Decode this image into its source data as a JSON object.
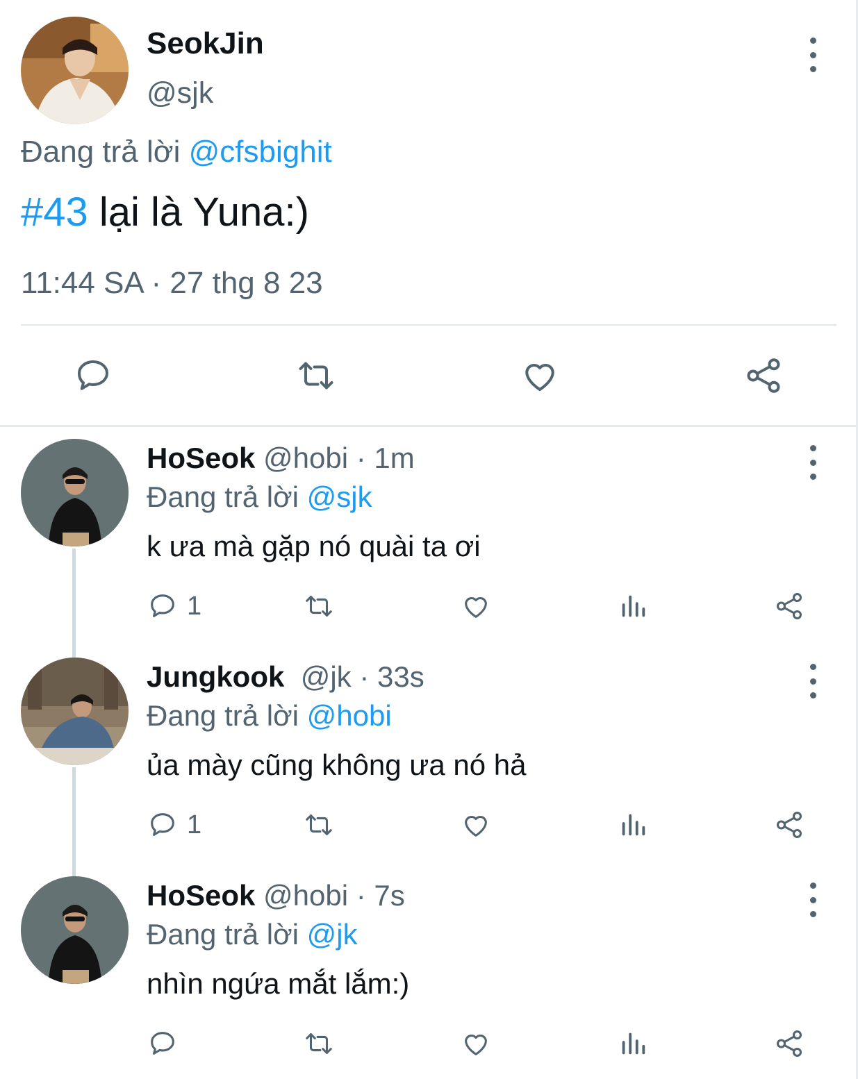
{
  "main_tweet": {
    "author_name": "SeokJin",
    "handle": "@sjk",
    "reply_prefix": "Đang trả lời",
    "reply_to": "@cfsbighit",
    "hashtag": "#43",
    "text": " lại là Yuna:)",
    "timestamp": "11:44 SA · 27 thg 8 23",
    "icons": [
      "reply-icon",
      "retweet-icon",
      "like-icon",
      "share-icon"
    ]
  },
  "replies": [
    {
      "author_name": "HoSeok",
      "meta": " @hobi · 1m",
      "reply_prefix": "Đang trả lời ",
      "reply_to": "@sjk",
      "text": "k ưa mà gặp nó quài ta ơi",
      "reply_count": "1"
    },
    {
      "author_name": "Jungkook",
      "meta": "  @jk · 33s",
      "reply_prefix": "Đang trả lời ",
      "reply_to": "@hobi",
      "text": "ủa mày cũng không ưa nó hả",
      "reply_count": "1"
    },
    {
      "author_name": "HoSeok",
      "meta": " @hobi · 7s",
      "reply_prefix": "Đang trả lời ",
      "reply_to": "@jk",
      "text": "nhìn ngứa mắt lắm:)",
      "reply_count": ""
    }
  ],
  "colors": {
    "accent": "#1d9bf0",
    "secondary_text": "#536471",
    "primary_text": "#0f1419"
  }
}
